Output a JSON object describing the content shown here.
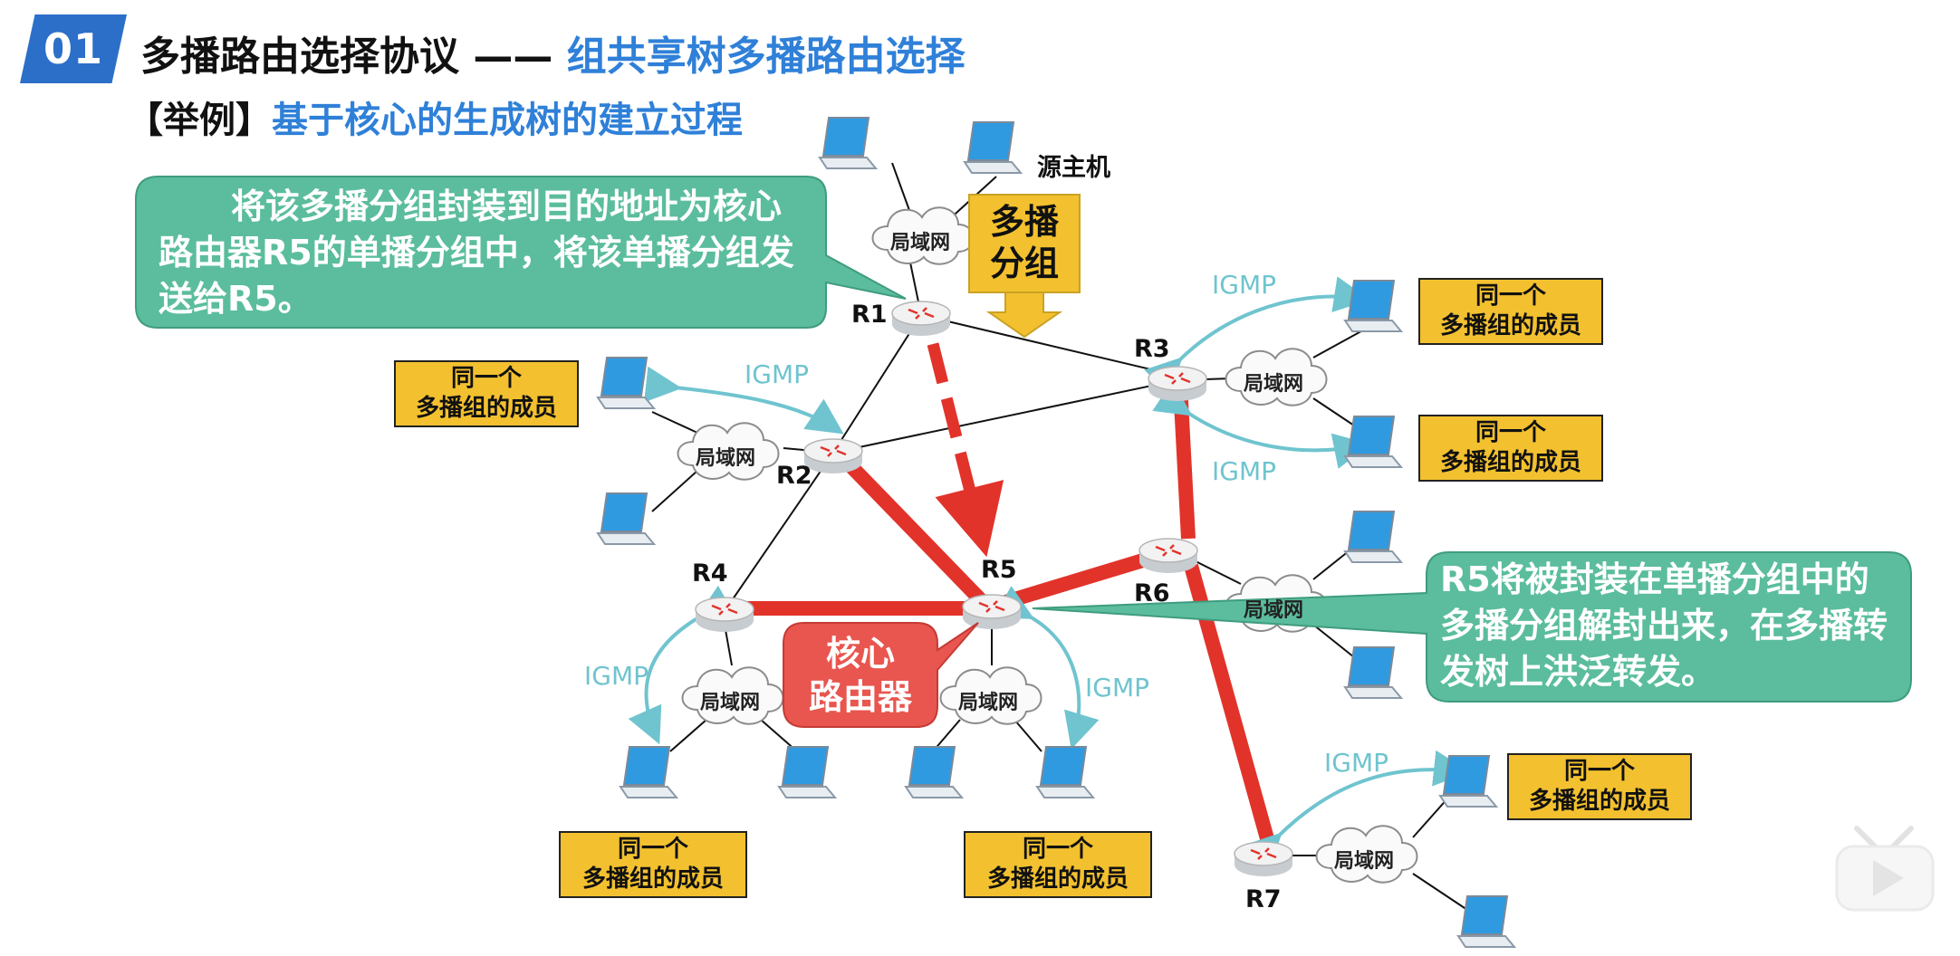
{
  "header": {
    "badge": "01",
    "title_main": "多播路由选择协议 ——",
    "title_highlight": "组共享树多播路由选择",
    "subtitle_bracket": "【举例】",
    "subtitle_highlight": "基于核心的生成树的建立过程"
  },
  "routers": [
    "R1",
    "R2",
    "R3",
    "R4",
    "R5",
    "R6",
    "R7"
  ],
  "lan_label": "局域网",
  "source_host_label": "源主机",
  "igmp_label": "IGMP",
  "member_line1": "同一个",
  "member_line2": "多播组的成员",
  "multicast_packet": {
    "line1": "多播",
    "line2": "分组"
  },
  "core_router": {
    "line1": "核心",
    "line2": "路由器"
  },
  "callout_left": "将该多播分组封装到目的地址为核心路由器R5的单播分组中，将该单播分组发送给R5。",
  "callout_right": "R5将被封装在单播分组中的多播分组解封出来，在多播转发树上洪泛转发。",
  "colors": {
    "accent_blue": "#2f80d8",
    "badge_blue": "#2c6fc9",
    "tree_red": "#e2332b",
    "callout_green": "#5bbd9d",
    "member_yellow": "#f3c12f",
    "igmp_teal": "#6fc4cf",
    "core_red": "#e8564f"
  }
}
